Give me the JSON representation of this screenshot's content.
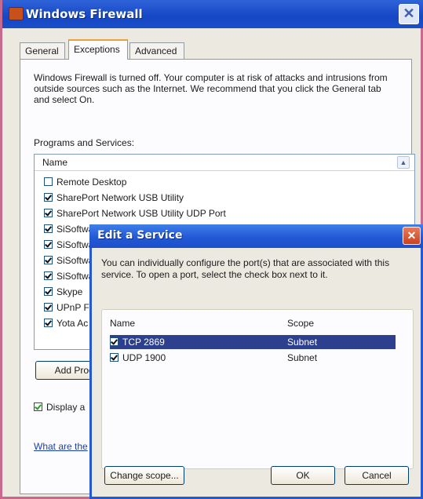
{
  "window": {
    "title": "Windows Firewall",
    "tabs": [
      "General",
      "Exceptions",
      "Advanced"
    ],
    "active_tab": "Exceptions",
    "warning_text": "Windows Firewall is turned off. Your computer is at risk of attacks and intrusions from outside sources such as the Internet. We recommend that you click the General tab and select On.",
    "programs_label": "Programs and Services:",
    "list": {
      "header": "Name",
      "items": [
        {
          "label": "Remote Desktop",
          "checked": false
        },
        {
          "label": "SharePort Network USB Utility",
          "checked": true
        },
        {
          "label": "SharePort Network USB Utility UDP Port",
          "checked": true
        },
        {
          "label": "SiSoftwa",
          "checked": true
        },
        {
          "label": "SiSoftwa",
          "checked": true
        },
        {
          "label": "SiSoftwa",
          "checked": true
        },
        {
          "label": "SiSoftwa",
          "checked": true
        },
        {
          "label": "Skype",
          "checked": true
        },
        {
          "label": "UPnP Fr",
          "checked": true
        },
        {
          "label": "Yota Ac",
          "checked": true
        }
      ]
    },
    "add_program_label": "Add Progra",
    "display_label": "Display a",
    "link_text": "What are the"
  },
  "dialog": {
    "title": "Edit a Service",
    "message": "You can individually configure the port(s) that are associated with this service. To open a port, select the check box next to it.",
    "col_name": "Name",
    "col_scope": "Scope",
    "ports": [
      {
        "name": "TCP 2869",
        "scope": "Subnet",
        "checked": true,
        "selected": true
      },
      {
        "name": "UDP 1900",
        "scope": "Subnet",
        "checked": true,
        "selected": false
      }
    ],
    "change_scope_label": "Change scope...",
    "ok_label": "OK",
    "cancel_label": "Cancel"
  }
}
